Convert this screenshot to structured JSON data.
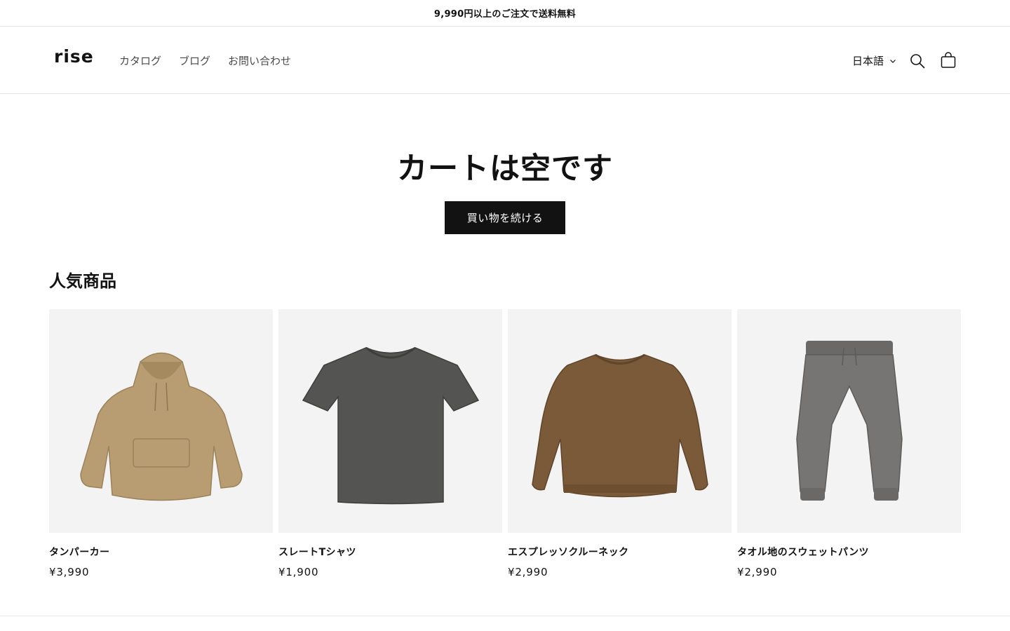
{
  "announcement": {
    "text": "9,990円以上のご注文で送料無料"
  },
  "header": {
    "logo": "rise",
    "nav": [
      {
        "label": "カタログ"
      },
      {
        "label": "ブログ"
      },
      {
        "label": "お問い合わせ"
      }
    ],
    "language": {
      "label": "日本語",
      "icon": "chevron-down-icon"
    },
    "search_icon": "search-icon",
    "cart_icon": "cart-icon"
  },
  "cart": {
    "empty_title": "カートは空です",
    "continue_label": "買い物を続ける"
  },
  "featured": {
    "title": "人気商品",
    "products": [
      {
        "name": "タンパーカー",
        "price": "¥3,990",
        "image": "hoodie",
        "color": "#b89c72"
      },
      {
        "name": "スレートTシャツ",
        "price": "¥1,900",
        "image": "tshirt",
        "color": "#545452"
      },
      {
        "name": "エスプレッソクルーネック",
        "price": "¥2,990",
        "image": "crewneck",
        "color": "#7a5a38"
      },
      {
        "name": "タオル地のスウェットパンツ",
        "price": "¥2,990",
        "image": "sweatpants",
        "color": "#767574"
      }
    ]
  },
  "colors": {
    "accent": "#121212",
    "tile_background": "#f3f3f3",
    "border": "#e6e6e6"
  }
}
